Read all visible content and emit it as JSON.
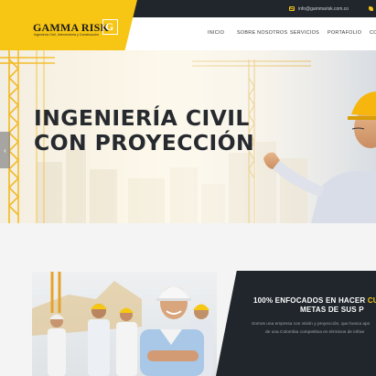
{
  "topbar": {
    "email": "info@gammarisk.com.co",
    "email_icon": "mail-icon",
    "phone_icon": "phone-icon"
  },
  "brand": {
    "name": "GAMMA RISK",
    "tagline": "Ingeniería Civil, Interventoría y Construcción",
    "mark": "G",
    "color": "#f7c513"
  },
  "nav": {
    "items": [
      "INICIO",
      "SOBRE NOSOTROS",
      "SERVICIOS",
      "PORTAFOLIO",
      "CO"
    ]
  },
  "hero": {
    "title_line1": "INGENIERÍA CIVIL",
    "title_line2": "CON PROYECCIÓN",
    "prev_arrow": "‹"
  },
  "about": {
    "title_part1": "100% ENFOCADOS EN HACER ",
    "title_highlight1": "CU",
    "title_highlight2": "METAS",
    "title_part2": " DE SUS P",
    "text_line1": "Somos una empresa con visión y proyección, que busca apo",
    "text_line2": "de una Colombia competitiva en términos de infrae"
  },
  "colors": {
    "accent": "#f5c518",
    "dark": "#20262c"
  }
}
